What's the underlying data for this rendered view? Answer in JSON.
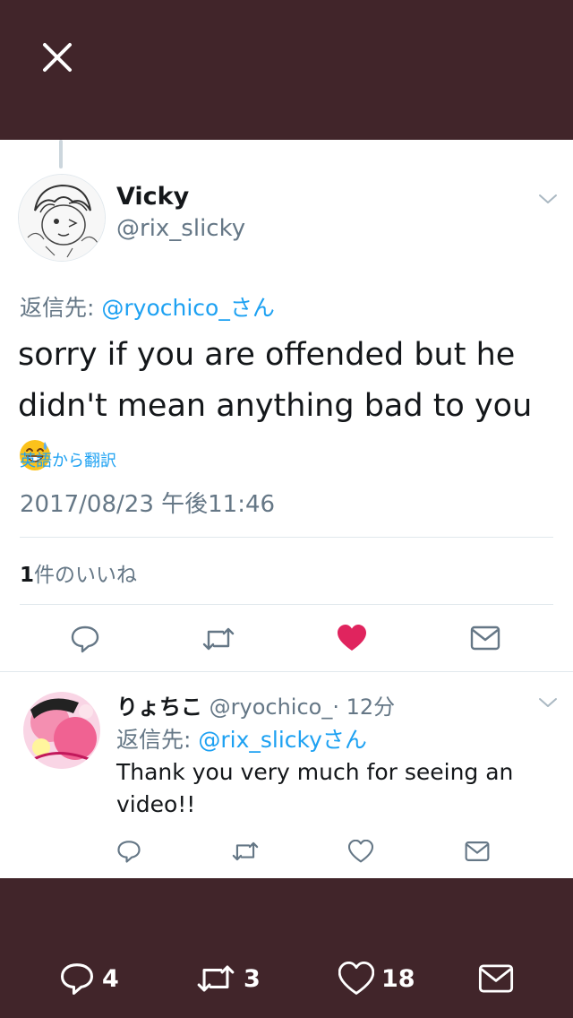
{
  "colors": {
    "background": "#41252a",
    "accent": "#1da1f2",
    "like": "#e0245e",
    "muted": "#657786"
  },
  "header": {
    "close_icon": "close-icon"
  },
  "tweet": {
    "name": "Vicky",
    "handle": "@rix_slicky",
    "replying_prefix": "返信先: ",
    "replying_to": "@ryochico_さん",
    "text": "sorry if you are offended but he didn't mean anything bad to you",
    "emoji_icon": "grinning-sweat-emoji",
    "translate": "英語から翻訳",
    "timestamp": "2017/08/23 午後11:46",
    "likes_count": "1",
    "likes_label": "件のいいね",
    "liked": true
  },
  "reply": {
    "name": "りょちこ",
    "handle": "@ryochico_",
    "time": "· 12分",
    "replying_prefix": "返信先: ",
    "replying_to": "@rix_slickyさん",
    "text": "Thank you very much for seeing an video!!"
  },
  "bottom": {
    "replies": "4",
    "retweets": "3",
    "likes": "18"
  }
}
